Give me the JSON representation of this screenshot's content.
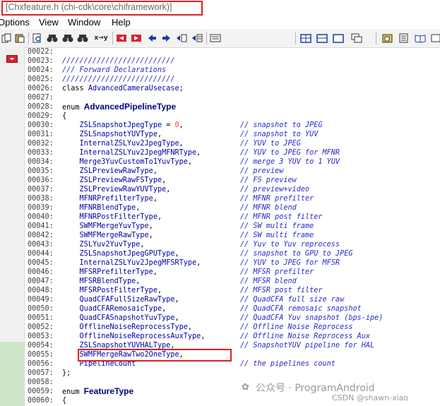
{
  "window": {
    "title": "[Chxfeature.h (chi-cdk\\core\\chiframework)]"
  },
  "menu": [
    "Options",
    "View",
    "Window",
    "Help"
  ],
  "toolbar_icons": [
    "copy-icon",
    "paste-icon",
    "search-icon",
    "find-binoculars-icon",
    "find-next-icon",
    "find-prev-icon",
    "replace-icon",
    "bookmark-prev-icon",
    "bookmark-next-icon",
    "back-arrow-icon",
    "forward-arrow-icon",
    "jump-icon",
    "list-icon",
    "window-tile-icon",
    "window-split-icon",
    "window-cascade-icon",
    "project-icon",
    "members-icon",
    "book-icon"
  ],
  "code_lines": [
    {
      "num": "00022:",
      "text": "",
      "comment": ""
    },
    {
      "num": "00023:",
      "text": "//////////////////////////",
      "comment": "",
      "kind": "comment"
    },
    {
      "num": "00024:",
      "text": "/// Forward Declarations",
      "comment": "",
      "kind": "comment"
    },
    {
      "num": "00025:",
      "text": "//////////////////////////",
      "comment": "",
      "kind": "comment"
    },
    {
      "num": "00026:",
      "text": "class AdvancedCameraUsecase;",
      "comment": "",
      "kind": "class"
    },
    {
      "num": "00027:",
      "text": "",
      "comment": ""
    },
    {
      "num": "00028:",
      "text": "enum AdvancedPipelineType",
      "comment": "",
      "kind": "enum"
    },
    {
      "num": "00029:",
      "text": "{",
      "comment": "",
      "kind": "punct"
    },
    {
      "num": "00030:",
      "text": "    ZSLSnapshotJpegType = 0,",
      "comment": "// snapshot to JPEG",
      "kind": "item0"
    },
    {
      "num": "00031:",
      "text": "    ZSLSnapshotYUVType,",
      "comment": "// snapshot to YUV",
      "kind": "item"
    },
    {
      "num": "00032:",
      "text": "    InternalZSLYuv2JpegType,",
      "comment": "// YUV to JPEG",
      "kind": "item"
    },
    {
      "num": "00033:",
      "text": "    InternalZSLYuv2JpegMFNRType,",
      "comment": "// YUV to JPEG for MFNR",
      "kind": "item"
    },
    {
      "num": "00034:",
      "text": "    Merge3YuvCustomTo1YuvType,",
      "comment": "// merge 3 YUV to 1 YUV",
      "kind": "item"
    },
    {
      "num": "00035:",
      "text": "    ZSLPreviewRawType,",
      "comment": "// preview",
      "kind": "item"
    },
    {
      "num": "00036:",
      "text": "    ZSLPreviewRawFSType,",
      "comment": "// FS preview",
      "kind": "item"
    },
    {
      "num": "00037:",
      "text": "    ZSLPreviewRawYUVType,",
      "comment": "// preview+video",
      "kind": "item"
    },
    {
      "num": "00038:",
      "text": "    MFNRPrefilterType,",
      "comment": "// MFNR prefilter",
      "kind": "item"
    },
    {
      "num": "00039:",
      "text": "    MFNRBlendType,",
      "comment": "// MFNR blend",
      "kind": "item"
    },
    {
      "num": "00040:",
      "text": "    MFNRPostFilterType,",
      "comment": "// MFNR post filter",
      "kind": "item"
    },
    {
      "num": "00041:",
      "text": "    SWMFMergeYuvType,",
      "comment": "// SW multi frame",
      "kind": "item"
    },
    {
      "num": "00042:",
      "text": "    SWMFMergeRawType,",
      "comment": "// SW multi frame",
      "kind": "item"
    },
    {
      "num": "00043:",
      "text": "    ZSLYuv2YuvType,",
      "comment": "// Yuv to Yuv reprocess",
      "kind": "item"
    },
    {
      "num": "00044:",
      "text": "    ZSLSnapshotJpegGPUType,",
      "comment": "// snapshot to GPU to JPEG",
      "kind": "item"
    },
    {
      "num": "00045:",
      "text": "    InternalZSLYuv2JpegMFSRType,",
      "comment": "// YUV to JPEG for MFSR",
      "kind": "item"
    },
    {
      "num": "00046:",
      "text": "    MFSRPrefilterType,",
      "comment": "// MFSR prefilter",
      "kind": "item"
    },
    {
      "num": "00047:",
      "text": "    MFSRBlendType,",
      "comment": "// MFSR blend",
      "kind": "item"
    },
    {
      "num": "00048:",
      "text": "    MFSRPostFilterType,",
      "comment": "// MFSR post filter",
      "kind": "item"
    },
    {
      "num": "00049:",
      "text": "    QuadCFAFullSizeRawType,",
      "comment": "// QuadCFA full size raw",
      "kind": "item"
    },
    {
      "num": "00050:",
      "text": "    QuadCFARemosaicType,",
      "comment": "// QuadCFA remosaic snapshot",
      "kind": "item"
    },
    {
      "num": "00051:",
      "text": "    QuadCFASnapshotYuvType,",
      "comment": "// QuadCFA Yuv snapshot (bps-ipe)",
      "kind": "item"
    },
    {
      "num": "00052:",
      "text": "    OfflineNoiseReprocessType,",
      "comment": "// Offline Noise Reprocess",
      "kind": "item"
    },
    {
      "num": "00053:",
      "text": "    OfflineNoiseReprocessAuxType,",
      "comment": "// Offline Noise Reprocess Aux",
      "kind": "item"
    },
    {
      "num": "00054:",
      "text": "    ZSLSnapshotYUVHALType,",
      "comment": "// SnapshotYUV pipeline for HAL",
      "kind": "item"
    },
    {
      "num": "00055:",
      "text": "    SWMFMergeRawTwo2OneType,",
      "comment": "",
      "kind": "item"
    },
    {
      "num": "00056:",
      "text": "    PipelineCount",
      "comment": "// the pipelines count",
      "kind": "item"
    },
    {
      "num": "00057:",
      "text": "};",
      "comment": "",
      "kind": "punct"
    },
    {
      "num": "00058:",
      "text": "",
      "comment": ""
    },
    {
      "num": "00059:",
      "text": "enum FeatureType",
      "comment": "",
      "kind": "enum"
    },
    {
      "num": "00060:",
      "text": "{",
      "comment": "",
      "kind": "punct"
    }
  ],
  "watermark": {
    "line1": "公众号 · ProgramAndroid",
    "line2": "CSDN @shawn-xiao"
  },
  "colors": {
    "highlight_border": "#e02020",
    "comment": "#2a2acb",
    "identifier": "#0000a0",
    "number": "#ff3b3b",
    "gutter_green": "#cde6c8"
  }
}
